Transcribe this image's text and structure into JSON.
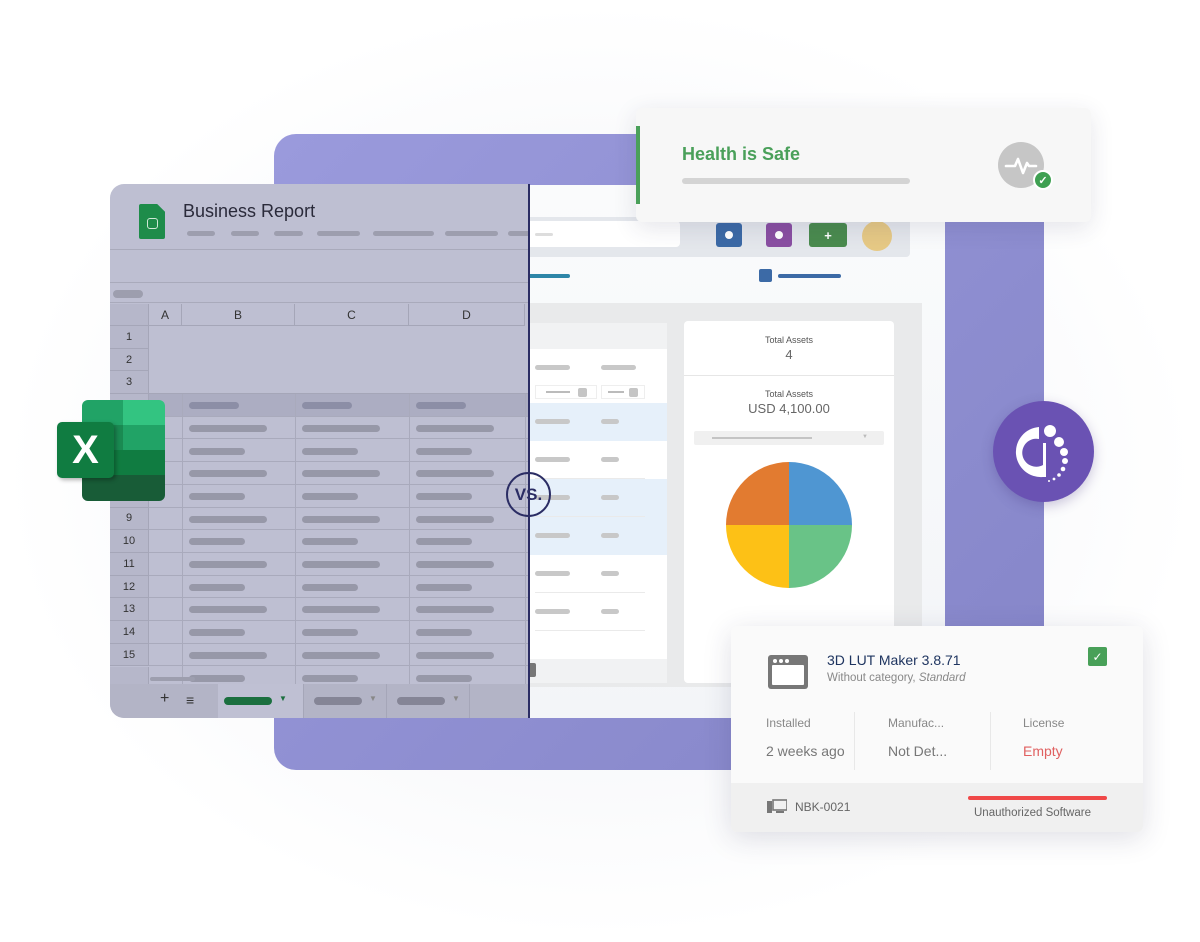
{
  "spreadsheet": {
    "title": "Business Report",
    "columns": [
      "A",
      "B",
      "C",
      "D"
    ],
    "rows": [
      "1",
      "2",
      "3",
      "",
      "",
      "",
      "",
      "",
      "9",
      "10",
      "11",
      "12",
      "13",
      "14",
      "15"
    ],
    "bottom_add": "+",
    "bottom_menu": "≡",
    "icon": "sheets-file-icon"
  },
  "excel_logo": {
    "letter": "X",
    "icon": "excel-logo-icon"
  },
  "vs_label": "VS.",
  "app_panel": {
    "toolbar_buttons": [
      {
        "icon": "dot-icon",
        "color": "#3c6aa6"
      },
      {
        "icon": "dot-icon",
        "color": "#8a4fa2"
      },
      {
        "icon": "plus-icon",
        "color": "#4a8b4e",
        "label": "+"
      }
    ],
    "avatar_color": "#e6c985",
    "summary": {
      "count_label": "Total Assets",
      "count_value": "4",
      "value_label": "Total Assets",
      "value_amount": "USD 4,100.00"
    }
  },
  "chart_data": {
    "type": "pie",
    "title": "",
    "slices": [
      {
        "label": "",
        "value": 25,
        "color": "#4f96d2"
      },
      {
        "label": "",
        "value": 25,
        "color": "#69c387"
      },
      {
        "label": "",
        "value": 25,
        "color": "#fdc116"
      },
      {
        "label": "",
        "value": 25,
        "color": "#e27b30"
      }
    ]
  },
  "health_card": {
    "title": "Health is Safe",
    "accent_color": "#4aa05a",
    "icon": "pulse-icon",
    "badge": "✓"
  },
  "software_card": {
    "name": "3D LUT Maker 3.8.71",
    "category": "Without category,",
    "category_type": "Standard",
    "checked": true,
    "check_glyph": "✓",
    "fields": [
      {
        "label": "Installed",
        "value": "2 weeks ago",
        "status": "normal"
      },
      {
        "label": "Manufac...",
        "value": "Not Det...",
        "status": "normal"
      },
      {
        "label": "License",
        "value": "Empty",
        "status": "warning"
      }
    ],
    "host": "NBK-0021",
    "status": "Unauthorized Software",
    "status_color": "#f04848"
  }
}
